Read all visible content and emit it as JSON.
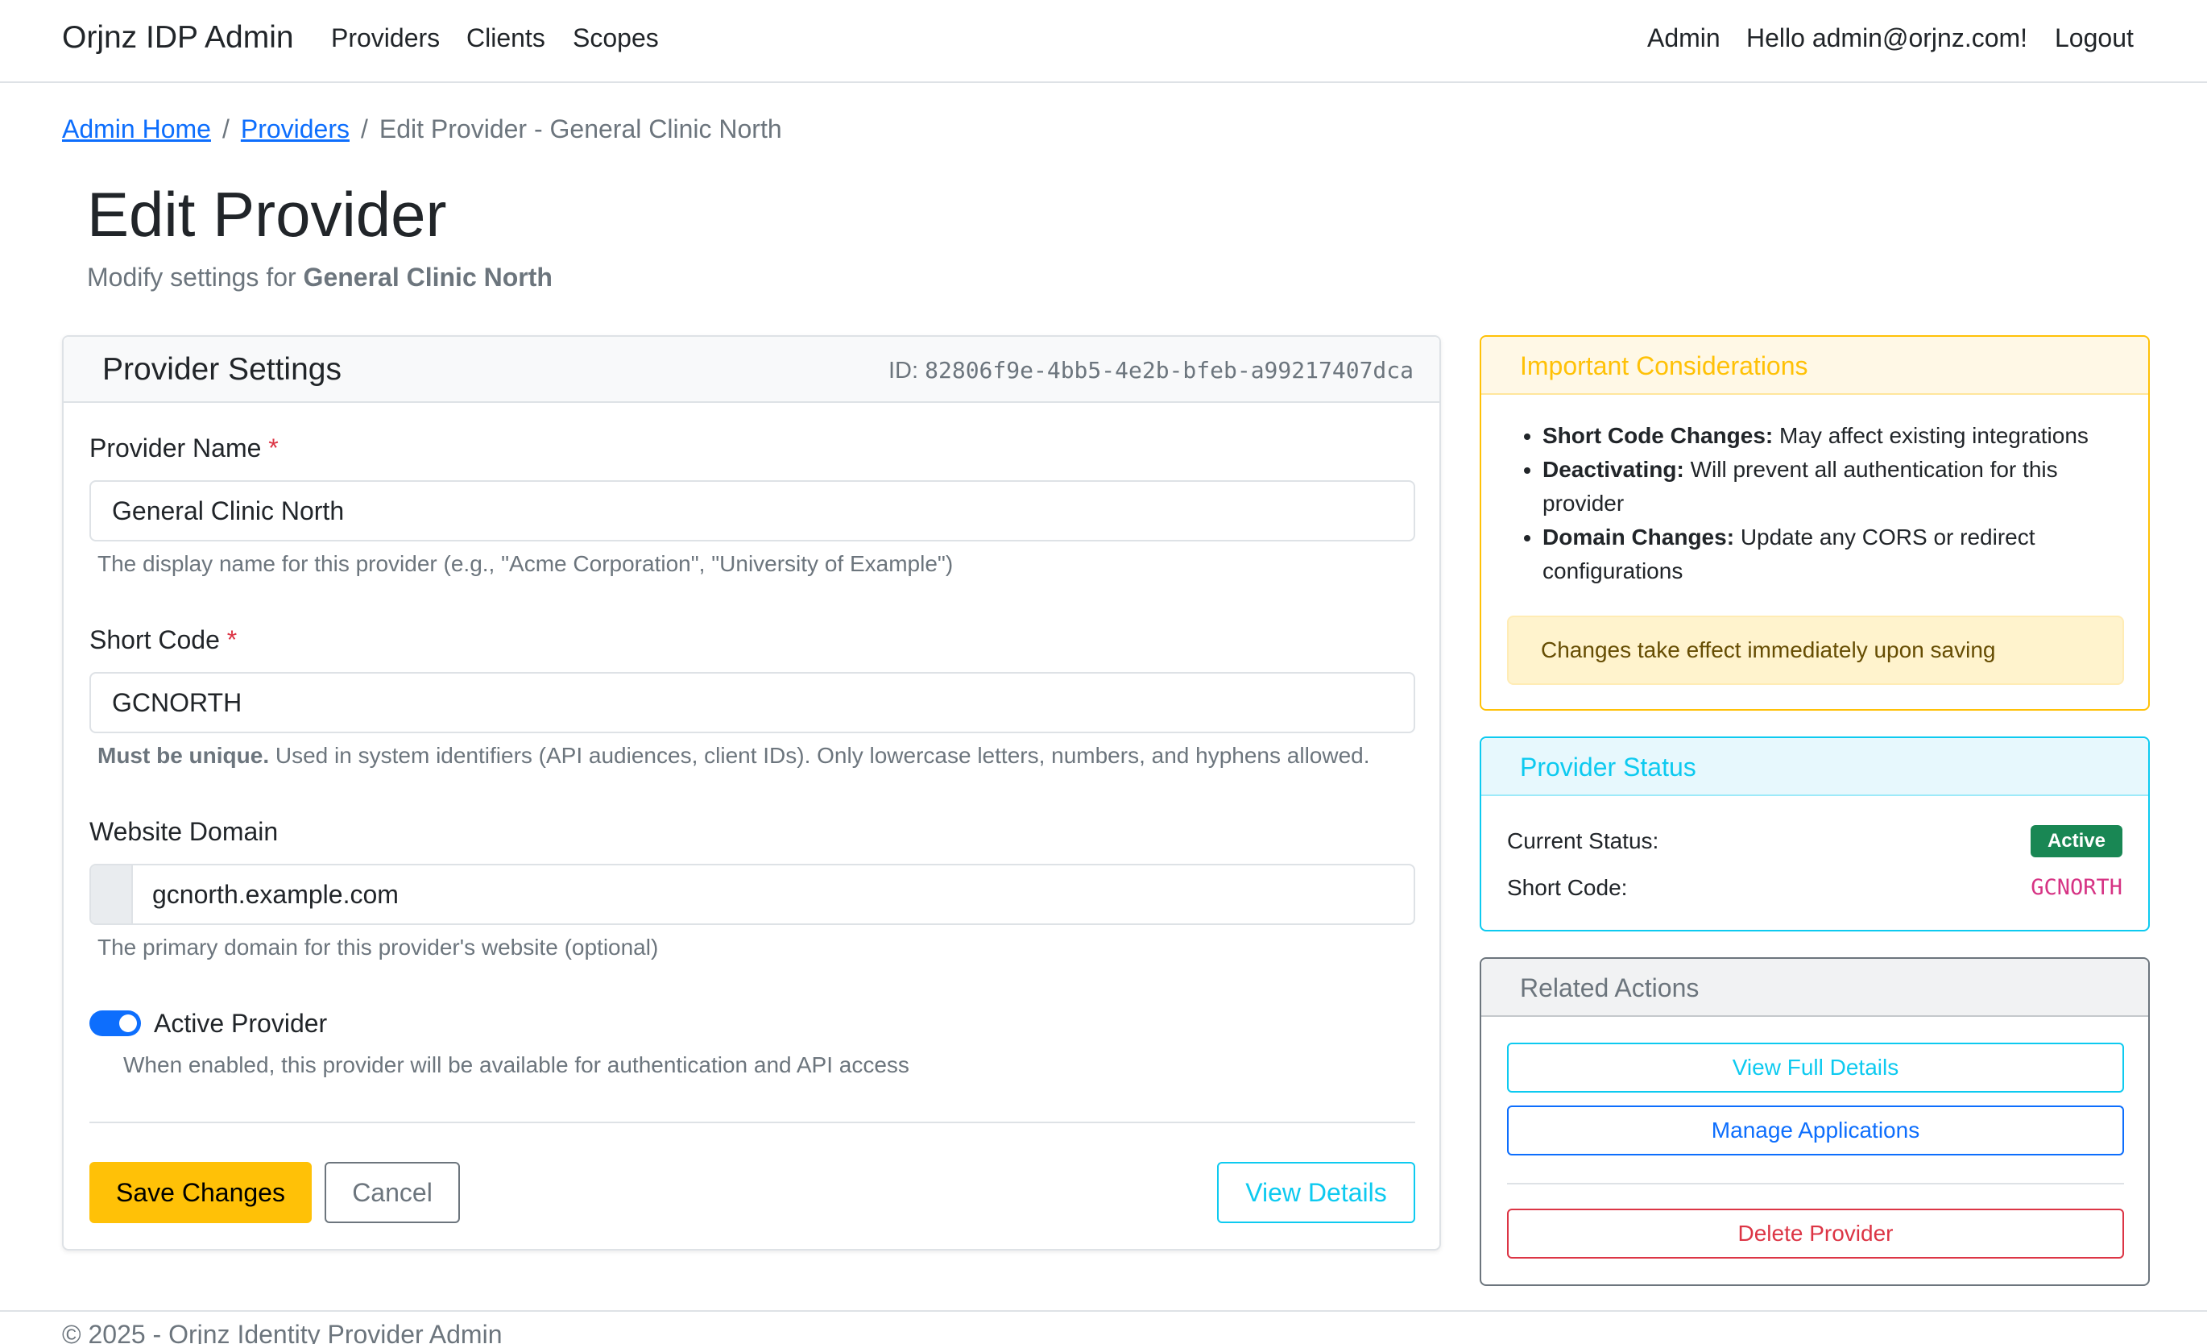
{
  "navbar": {
    "brand": "Orjnz IDP Admin",
    "links": [
      "Providers",
      "Clients",
      "Scopes"
    ],
    "admin": "Admin",
    "greeting": "Hello admin@orjnz.com!",
    "logout": "Logout"
  },
  "breadcrumb": {
    "home": "Admin Home",
    "providers": "Providers",
    "current": "Edit Provider - General Clinic North",
    "separator": "/"
  },
  "page": {
    "title": "Edit Provider",
    "subtitle_prefix": "Modify settings for",
    "subtitle_name": "General Clinic North"
  },
  "form": {
    "header_title": "Provider Settings",
    "id_label": "ID:",
    "id_value": "82806f9e-4bb5-4e2b-bfeb-a99217407dca",
    "required_marker": "*",
    "name": {
      "label": "Provider Name",
      "value": "General Clinic North",
      "help": "The display name for this provider (e.g., \"Acme Corporation\", \"University of Example\")"
    },
    "short_code": {
      "label": "Short Code",
      "value": "GCNORTH",
      "help_bold": "Must be unique.",
      "help": "Used in system identifiers (API audiences, client IDs). Only lowercase letters, numbers, and hyphens allowed."
    },
    "domain": {
      "label": "Website Domain",
      "value": "gcnorth.example.com",
      "help": "The primary domain for this provider's website (optional)"
    },
    "active": {
      "label": "Active Provider",
      "checked": true,
      "help": "When enabled, this provider will be available for authentication and API access"
    },
    "buttons": {
      "save": "Save Changes",
      "cancel": "Cancel",
      "view": "View Details"
    }
  },
  "considerations": {
    "title": "Important Considerations",
    "items": [
      {
        "bold": "Short Code Changes:",
        "text": "May affect existing integrations"
      },
      {
        "bold": "Deactivating:",
        "text": "Will prevent all authentication for this provider"
      },
      {
        "bold": "Domain Changes:",
        "text": "Update any CORS or redirect configurations"
      }
    ],
    "alert": "Changes take effect immediately upon saving"
  },
  "status": {
    "title": "Provider Status",
    "current_label": "Current Status:",
    "current_value": "Active",
    "code_label": "Short Code:",
    "code_value": "GCNORTH"
  },
  "actions": {
    "title": "Related Actions",
    "view_full": "View Full Details",
    "manage_apps": "Manage Applications",
    "delete": "Delete Provider"
  },
  "footer": {
    "text": "© 2025 - Orjnz Identity Provider Admin"
  },
  "colors": {
    "primary": "#0d6efd",
    "warning": "#ffc107",
    "info": "#0dcaf0",
    "success": "#198754",
    "danger": "#dc3545",
    "secondary": "#6c757d"
  }
}
